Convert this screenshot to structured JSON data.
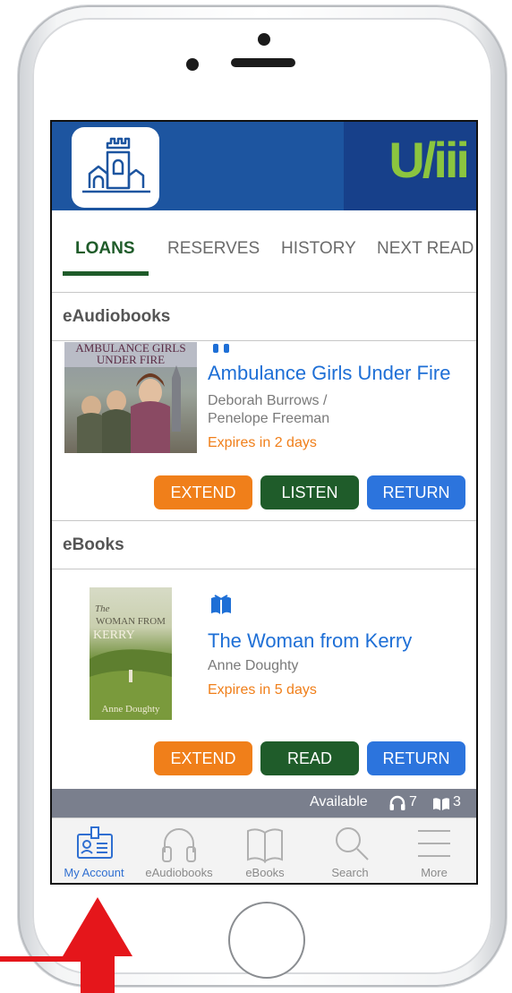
{
  "tabs": [
    {
      "label": "LOANS",
      "active": true
    },
    {
      "label": "RESERVES",
      "active": false
    },
    {
      "label": "HISTORY",
      "active": false
    },
    {
      "label": "NEXT READ",
      "active": false
    }
  ],
  "brand_text": "U/iii",
  "sections": {
    "audiobooks": {
      "header": "eAudiobooks",
      "item": {
        "cover_text": "AMBULANCE GIRLS UNDER FIRE",
        "type_icon": "headphones-icon",
        "title": "Ambulance Girls Under Fire",
        "author_line1": "Deborah Burrows /",
        "author_line2": "Penelope Freeman",
        "expiry": "Expires in 2 days",
        "extend_label": "EXTEND",
        "action_label": "LISTEN",
        "return_label": "RETURN"
      }
    },
    "ebooks": {
      "header": "eBooks",
      "item": {
        "cover_text_top": "The",
        "cover_text_mid": "WOMAN FROM",
        "cover_text_kerry": "KERRY",
        "cover_text_author": "Anne Doughty",
        "type_icon": "book-icon",
        "title": "The Woman from Kerry",
        "author": "Anne Doughty",
        "expiry": "Expires in 5 days",
        "extend_label": "EXTEND",
        "action_label": "READ",
        "return_label": "RETURN"
      }
    }
  },
  "availability": {
    "label": "Available",
    "audiobook_count": "7",
    "ebook_count": "3"
  },
  "tabbar": [
    {
      "label": "My Account",
      "icon": "account-card-icon",
      "active": true
    },
    {
      "label": "eAudiobooks",
      "icon": "headphones-icon",
      "active": false
    },
    {
      "label": "eBooks",
      "icon": "open-book-icon",
      "active": false
    },
    {
      "label": "Search",
      "icon": "search-icon",
      "active": false
    },
    {
      "label": "More",
      "icon": "menu-icon",
      "active": false
    }
  ],
  "colors": {
    "header_blue": "#1d55a0",
    "active_green": "#1f5c2a",
    "link_blue": "#1e6fd6",
    "expire_orange": "#f07f1a",
    "return_blue": "#2c74dd",
    "annotation_red": "#e5161b"
  }
}
